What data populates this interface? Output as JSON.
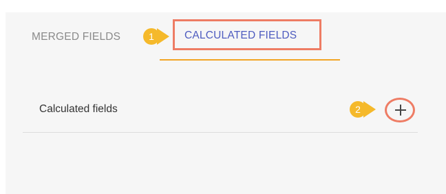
{
  "tabs": {
    "merged_label": "MERGED FIELDS",
    "calculated_label": "CALCULATED FIELDS",
    "active": "calculated"
  },
  "callouts": [
    "1",
    "2"
  ],
  "section": {
    "label": "Calculated fields"
  },
  "icons": {
    "add": "plus-icon"
  },
  "colors": {
    "highlight": "#ee7c64",
    "callout": "#f5b92b",
    "active_tab_text": "#4d5bbf",
    "active_tab_underline": "#f2a524",
    "panel_background": "#f6f6f6"
  }
}
